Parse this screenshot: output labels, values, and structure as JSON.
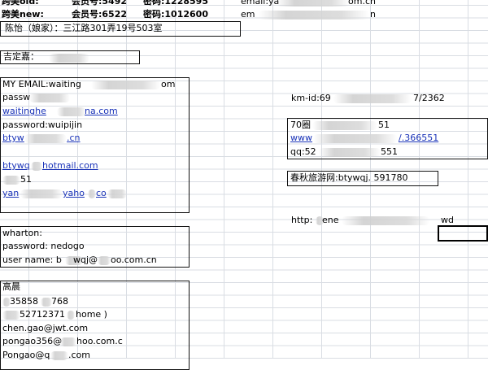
{
  "block1": {
    "row1_a": "跨美old:",
    "row1_b": "会员号:5492",
    "row1_c": "密码:1228595",
    "row1_d": "email:ya",
    "row1_e": "om.cn",
    "row2_a": "跨美new:",
    "row2_b": "会员号:6522",
    "row2_c": "密码:1012600",
    "row2_d": "em",
    "row2_e": "n",
    "address": "陈怡（娘家）：三江路301弄19号503室"
  },
  "jiding": {
    "label": "吉定嘉："
  },
  "myemail": {
    "line1": "MY EMAIL:waiting",
    "line1_end": "om",
    "line2": "passw",
    "line3_a": "waitinghe",
    "line3_b": "na.com",
    "line4": "password:wuipijin",
    "line5_a": "btyw",
    "line5_b": ".cn",
    "line6_a": "btywq",
    "line6_b": "hotmail.com",
    "line7": "51",
    "line8_a": "yan",
    "line8_b": "yaho",
    "line8_c": "co"
  },
  "wharton": {
    "line1": "wharton:",
    "line2": "password: nedogo",
    "line3_a": "user name: b",
    "line3_b": "wqj@",
    "line3_c": "oo.com.cn"
  },
  "gaochen": {
    "name": "高晨",
    "line2_a": "35858",
    "line2_b": "768",
    "line3_a": "52712371",
    "line3_b": "home )",
    "line4": "chen.gao@jwt.com",
    "line5_a": "pongao356@",
    "line5_b": "hoo.com.c",
    "line6_a": "Pongao@q",
    "line6_b": ".com"
  },
  "kmid": {
    "a": "km-id:69",
    "b": "7/2362"
  },
  "box70": {
    "line1_a": "70圈",
    "line1_b": "51",
    "line2_a": "www",
    "line2_b": "/.366551",
    "line3_a": "qq:52",
    "line3_b": "551"
  },
  "chunqiu": {
    "text": "春秋旅游网:btywqj. 591780"
  },
  "http": {
    "a": "http:",
    "b": "ene"
  },
  "wd": {
    "text": "wd"
  },
  "colors": {
    "link": "#1a33b8",
    "grid": "#d9dde3",
    "border": "#111111"
  }
}
